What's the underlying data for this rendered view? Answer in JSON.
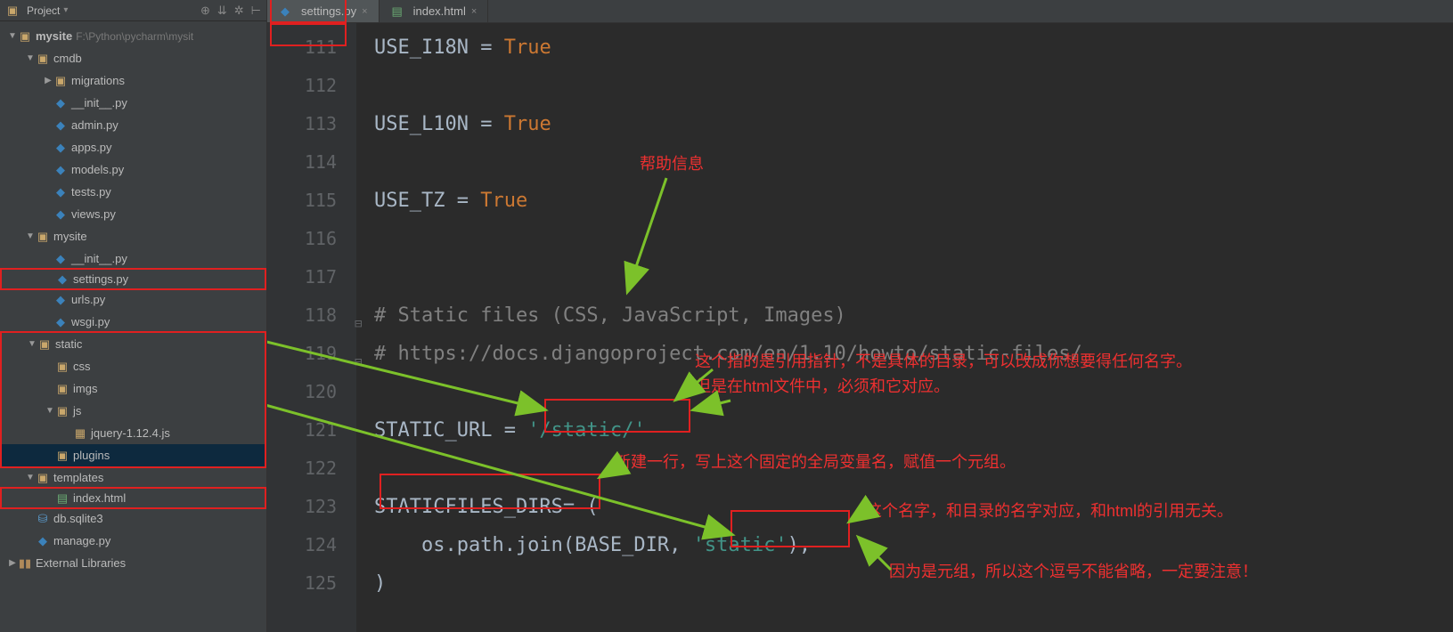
{
  "sidebar": {
    "title": "Project",
    "root": {
      "name": "mysite",
      "path": "F:\\Python\\pycharm\\mysit"
    },
    "tree": {
      "cmdb": {
        "label": "cmdb",
        "migrations": "migrations",
        "init": "__init__.py",
        "admin": "admin.py",
        "apps": "apps.py",
        "models": "models.py",
        "tests": "tests.py",
        "views": "views.py"
      },
      "mysite": {
        "label": "mysite",
        "init": "__init__.py",
        "settings": "settings.py",
        "urls": "urls.py",
        "wsgi": "wsgi.py"
      },
      "static": {
        "label": "static",
        "css": "css",
        "imgs": "imgs",
        "js": "js",
        "jquery": "jquery-1.12.4.js",
        "plugins": "plugins"
      },
      "templates": {
        "label": "templates",
        "index": "index.html"
      },
      "db": "db.sqlite3",
      "manage": "manage.py",
      "external": "External Libraries"
    }
  },
  "tabs": [
    {
      "name": "settings.py",
      "active": true
    },
    {
      "name": "index.html",
      "active": false
    }
  ],
  "code": {
    "lines": [
      111,
      112,
      113,
      114,
      115,
      116,
      117,
      118,
      119,
      120,
      121,
      122,
      123,
      124,
      125
    ],
    "l111_a": "USE_I18N = ",
    "l111_b": "True",
    "l113_a": "USE_L10N = ",
    "l113_b": "True",
    "l115_a": "USE_TZ = ",
    "l115_b": "True",
    "l118": "# Static files (CSS, JavaScript, Images)",
    "l119": "# https://docs.djangoproject.com/en/1.10/howto/static-files/",
    "l121_a": "STATIC_URL = ",
    "l121_b": "'/static/'",
    "l123_a": "STATICFILES_DIRS",
    "l123_b": "= (",
    "l124_a": "    os.path.join(BASE_DIR, ",
    "l124_b": "'static'",
    "l124_c": "),",
    "l125": ")"
  },
  "annotations": {
    "help": "帮助信息",
    "url1": "这个指的是引用指针，不是具体的目录，可以改成你想要得任何名字。",
    "url2": "但是在html文件中，必须和它对应。",
    "dirs": "新建一行，写上这个固定的全局变量名，赋值一个元组。",
    "static_name": "这个名字，和目录的名字对应，和html的引用无关。",
    "comma": "因为是元组，所以这个逗号不能省略，一定要注意！"
  }
}
